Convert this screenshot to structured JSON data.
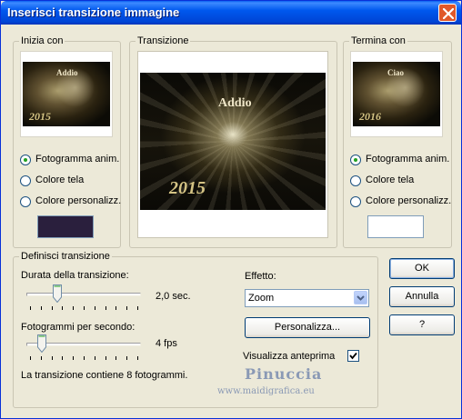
{
  "window": {
    "title": "Inserisci transizione immagine"
  },
  "start_group": {
    "label": "Inizia con",
    "thumb_title": "Addio",
    "thumb_year": "2015",
    "options": [
      {
        "label": "Fotogramma anim.",
        "checked": true
      },
      {
        "label": "Colore tela",
        "checked": false
      },
      {
        "label": "Colore personalizz.",
        "checked": false
      }
    ],
    "color": "#2a1f3d"
  },
  "transition_group": {
    "label": "Transizione",
    "thumb_title": "Addio",
    "thumb_year": "2015"
  },
  "end_group": {
    "label": "Termina con",
    "thumb_title": "Ciao",
    "thumb_year": "2016",
    "options": [
      {
        "label": "Fotogramma anim.",
        "checked": true
      },
      {
        "label": "Colore tela",
        "checked": false
      },
      {
        "label": "Colore personalizz.",
        "checked": false
      }
    ],
    "color": "#ffffff"
  },
  "define_group": {
    "label": "Definisci transizione",
    "duration_label": "Durata della transizione:",
    "duration_value": "2,0 sec.",
    "duration_fraction": 0.25,
    "fps_label": "Fotogrammi per secondo:",
    "fps_value": "4 fps",
    "fps_fraction": 0.1,
    "info": "La transizione contiene 8 fotogrammi.",
    "effect_label": "Effetto:",
    "effect_value": "Zoom",
    "customize_label": "Personalizza...",
    "preview_label": "Visualizza anteprima",
    "preview_checked": true
  },
  "buttons": {
    "ok": "OK",
    "cancel": "Annulla",
    "help": "?"
  },
  "watermark": {
    "name": "Pinuccia",
    "url": "www.maidigrafica.eu"
  }
}
